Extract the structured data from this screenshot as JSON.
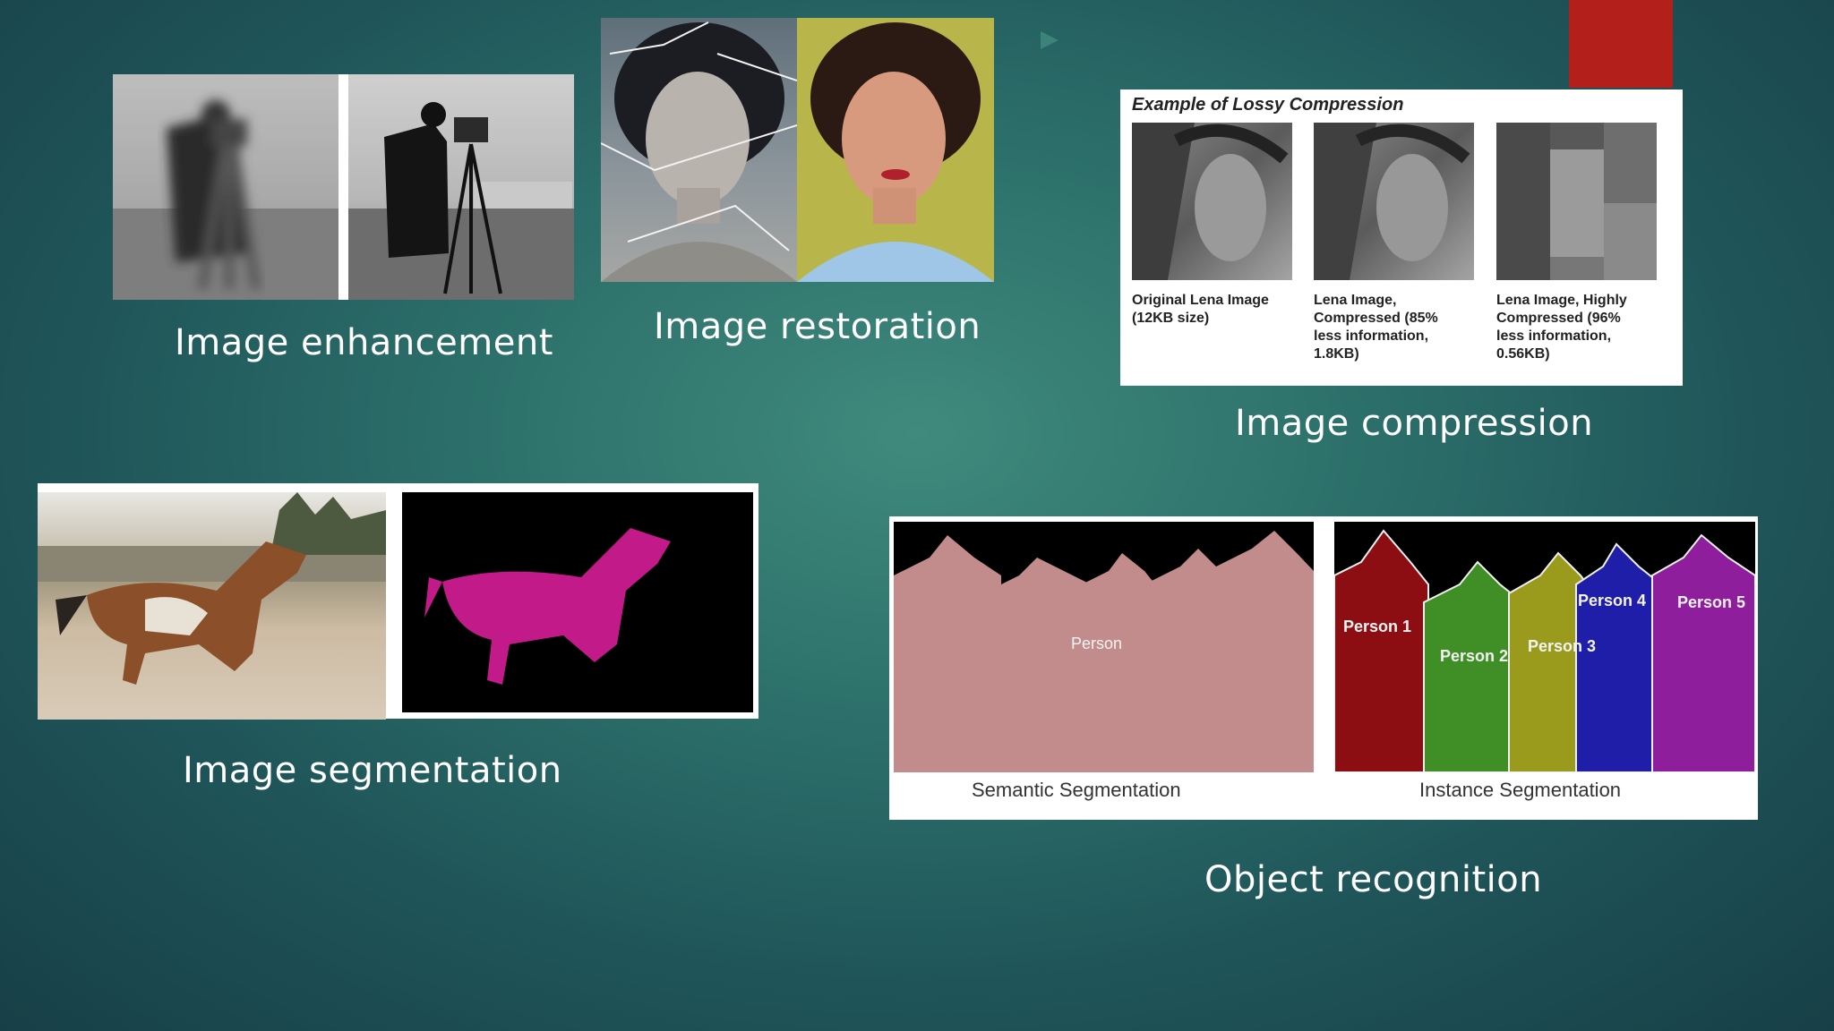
{
  "slide": {
    "accent_color": "#b3201c"
  },
  "panels": {
    "enhancement": {
      "caption": "Image enhancement"
    },
    "restoration": {
      "caption": "Image restoration"
    },
    "compression": {
      "caption": "Image compression",
      "figure_title": "Example of Lossy Compression",
      "images": [
        {
          "label_lines": [
            "Original Lena Image",
            "(12KB size)"
          ]
        },
        {
          "label_lines": [
            "Lena Image,",
            "Compressed (85%",
            "less information,",
            "1.8KB)"
          ]
        },
        {
          "label_lines": [
            "Lena Image, Highly",
            "Compressed (96%",
            "less information,",
            "0.56KB)"
          ]
        }
      ]
    },
    "segmentation": {
      "caption": "Image segmentation",
      "mask_color": "#c31a8a"
    },
    "object_recognition": {
      "caption": "Object recognition",
      "semantic_label": "Semantic Segmentation",
      "instance_label": "Instance Segmentation",
      "semantic_person": "Person",
      "instances": [
        {
          "name": "Person 1",
          "color": "#8c0e12"
        },
        {
          "name": "Person 2",
          "color": "#3f8f26"
        },
        {
          "name": "Person 3",
          "color": "#9a9a1c"
        },
        {
          "name": "Person 4",
          "color": "#1e1ea8"
        },
        {
          "name": "Person 5",
          "color": "#8e1e9c"
        }
      ],
      "semantic_color": "#c38c8c"
    }
  }
}
